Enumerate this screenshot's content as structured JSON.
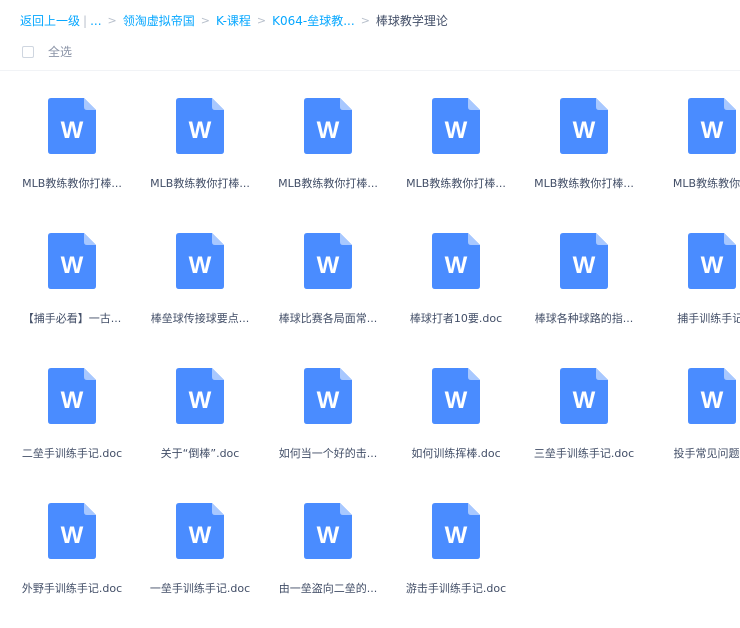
{
  "breadcrumb": {
    "back_label": "返回上一级",
    "ellipsis": "...",
    "crumbs": [
      "领淘虚拟帝国",
      "K-课程",
      "K064-垒球教..."
    ],
    "current": "棒球教学理论",
    "separator": ">",
    "bar": "|"
  },
  "toolbar": {
    "select_all_label": "全选"
  },
  "icon": {
    "letter": "W",
    "color": "#4a8cff",
    "fold_color": "#a8c8ff"
  },
  "files": [
    {
      "name": "MLB教练教你打棒..."
    },
    {
      "name": "MLB教练教你打棒..."
    },
    {
      "name": "MLB教练教你打棒..."
    },
    {
      "name": "MLB教练教你打棒..."
    },
    {
      "name": "MLB教练教你打棒..."
    },
    {
      "name": "MLB教练教你打"
    },
    {
      "name": "【捕手必看】一古..."
    },
    {
      "name": "棒垒球传接球要点..."
    },
    {
      "name": "棒球比赛各局面常..."
    },
    {
      "name": "棒球打者10要.doc"
    },
    {
      "name": "棒球各种球路的指..."
    },
    {
      "name": "捕手训练手记."
    },
    {
      "name": "二垒手训练手记.doc"
    },
    {
      "name": "关于“倒棒”.doc"
    },
    {
      "name": "如何当一个好的击..."
    },
    {
      "name": "如何训练挥棒.doc"
    },
    {
      "name": "三垒手训练手记.doc"
    },
    {
      "name": "投手常见问题解"
    },
    {
      "name": "外野手训练手记.doc"
    },
    {
      "name": "一垒手训练手记.doc"
    },
    {
      "name": "由一垒盗向二垒的..."
    },
    {
      "name": "游击手训练手记.doc"
    }
  ]
}
